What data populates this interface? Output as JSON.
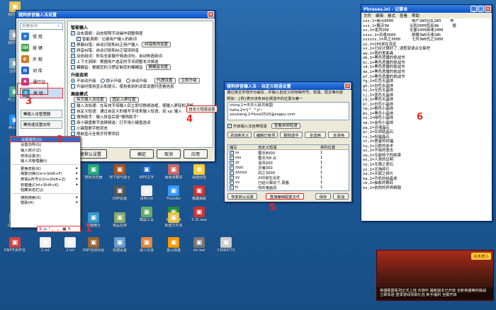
{
  "settings_window": {
    "title": "搜狗拼音输入法设置",
    "search_placeholder": "查看各项",
    "nav": [
      {
        "label": "常  用",
        "color": "#2e7ad1"
      },
      {
        "label": "按  键",
        "color": "#3d9a3d"
      },
      {
        "label": "外  观",
        "color": "#d07a20"
      },
      {
        "label": "词  库",
        "color": "#2a66c8"
      },
      {
        "label": "通行证",
        "color": "#c43c8a"
      },
      {
        "label": "高  级",
        "color": "#2e8fb0"
      }
    ],
    "nav_buttons": [
      "输入法管理器",
      "快速设置向导"
    ],
    "sections": {
      "smart": "智能输入",
      "upgrade": "升级选项",
      "advanced": "高级模式"
    },
    "smart_options": [
      "动态调频：动态按照手动操作调整频度",
      "智能调频：记录用户输入的新词",
      "屏蔽纠错：自动识别和纠正用户输入",
      "拼音纠错：自动识别和纠正错误拼音",
      "动态组词：所有全部展开候选词句，自动构造新词",
      "上下文调频：根据用户选定的字词调整本次候选",
      "模糊音：根据您的习惯定制您的模糊音"
    ],
    "smart_buttons": [
      "纠错规则设置",
      "模糊音设置"
    ],
    "upgrade_options": [
      "不自动升级",
      "提示升级",
      "自动升级"
    ],
    "upgrade_buttons": [
      "代理设置",
      "立即升级"
    ],
    "upgrade_note": "升级时使用显示和提示，使用收到的词库设置时查看信息",
    "advanced_buttons": [
      "英文输入法设置",
      "固定上屏位置"
    ],
    "advanced_options": [
      "输入法加速：在有效字母输入后立即切换候选框，使输入更轻松流畅",
      "自定义短语：通过自定义的缩写字母来输入短语，如 xjc 输入",
      "搜狗助手：输入拼音后按\"搜狗助手\"",
      "用小键盘数字选择候选：打开用小键盘选词",
      "小键盘数字框状态",
      "限制显示全角字符等项目"
    ],
    "custom_phrase_button": "自定义短语设置",
    "footer": [
      "恢复默认设置",
      "确定",
      "取消",
      "应用"
    ]
  },
  "context_menu": {
    "items": [
      {
        "label": "设置属性(O)",
        "sub": false,
        "selected": true
      },
      {
        "label": "设置向导(G)",
        "sub": false,
        "selected": false
      },
      {
        "label": "输入统计(Z)",
        "sub": false,
        "selected": false
      },
      {
        "label": "修改设置(E)",
        "sub": false,
        "selected": false
      },
      {
        "label": "输入法管理器(I)",
        "sub": false,
        "selected": false
      },
      {
        "label": "更换皮肤(K)",
        "sub": true,
        "selected": false
      },
      {
        "label": "简繁切换(Ctrl+Shift+F)",
        "sub": true,
        "selected": false
      },
      {
        "label": "表情&符号(Ctrl+Shift+Z)",
        "sub": true,
        "selected": false
      },
      {
        "label": "软键盘(Ctrl+Shift+K)",
        "sub": true,
        "selected": false
      },
      {
        "label": "隐藏状态栏(J)",
        "sub": false,
        "selected": false
      },
      {
        "label": "搜狗搜索(S)",
        "sub": true,
        "selected": false
      },
      {
        "label": "帮助(H)",
        "sub": true,
        "selected": false
      }
    ]
  },
  "ime_bar": {
    "logo": "S",
    "mode": "中",
    "items": [
      "°",
      "，",
      "。",
      "▦",
      "✎"
    ]
  },
  "phrase_dialog": {
    "title": "搜狗拼音输入法 - 自定义短语设置",
    "instructions": [
      "通过英文字母作为缩写，并输入自定义的特殊符号，短语，短文等内容",
      "例如：{例}表示该条目在候选中的位置为第一",
      "china,1=中华人民共和国",
      "haha,2=\\(^_^)/~"
    ],
    "textarea_lines": [
      "china,1=中华人民共和国",
      "haha,2=\\(^_^)/~",
      "youxiang,2=love2520@sogou.com"
    ],
    "link": "查看自带短语",
    "checkbox_label": "开启输入法自带短语",
    "buttons_row": [
      "添加新定义",
      "编辑已有项",
      "删除选中",
      "全选用",
      "全清用"
    ],
    "table_headers": [
      "缩写",
      "自定义短语",
      "排列位置"
    ],
    "table_rows": [
      {
        "abbr": "ss",
        "phrase": "蜀沃8000",
        "pos": "1"
      },
      {
        "abbr": "sss",
        "phrase": "蜀沃3W          尖",
        "pos": "1"
      },
      {
        "abbr": "zz",
        "phrase": "凛冽200         ",
        "pos": "1"
      },
      {
        "abbr": "zzzz",
        "phrase": "灵魂300",
        "pos": "1"
      },
      {
        "abbr": "zzzzzz",
        "phrase": "风之3000",
        "pos": "1"
      },
      {
        "abbr": "yy",
        "phrase": "200说在设定",
        "pos": "1"
      },
      {
        "abbr": "vv",
        "phrase": "已经计算好了,再看",
        "pos": "1"
      },
      {
        "abbr": "tt",
        "phrase": "你的鬼面具",
        "pos": "1"
      }
    ],
    "footer_buttons": [
      "恢复默认设置",
      "直接编辑配置文件",
      "保存",
      "取消"
    ]
  },
  "notepad": {
    "title": "Phrases.ini - 记事本",
    "menu": [
      "文件",
      "编辑",
      "格式",
      "查看",
      "帮助"
    ],
    "lines": [
      "zzz,1=蜀沃8000        嫉严2W3狂乱2W3    熊",
      "sss,1=蜀沃3W         尖刺2000死岳4W      擢",
      "zz,1=凛冽200         无量1000英魂1000",
      "zzzz,1=灵魂3600       剧属3W0天魂2W5",
      "zzzzzz,1=风之3000     七件3W0光之3000",
      "yy,1=200说在设定",
      "vv,1=已经计算好了,请惹就请点交易吧",
      "ww,1=我的鬼面具",
      "ab,1=黑色恶魔的挑战书",
      "bc,1=黑色恶魔的挑战书",
      "cd,1=黑色恶魔的挑战书",
      "de,1=黑色恶魔的挑战书",
      "ef,1=黑色恶魔的挑战书",
      "fg,1=红色天晶体",
      "gh,1=白色水晶体",
      "hi,1=无色天晶体",
      "ij,1=蓝色天晶体",
      "jk,1=黑色天晶体",
      "kl,1=白色小晶体",
      "lm,1=紫色小晶体",
      "mn,1=黑色小晶体",
      "no,1=绿色小晶体",
      "op,1=金色小晶体",
      "pq,1=灵魂晶石",
      "qr,1=灰烬结晶石",
      "rs,1=祝福晶石",
      "st,1=勇者的祝福",
      "tu,1=沉默的羔羊",
      "uv,1=不染的意志",
      "vw,1=无敌特子的勋章",
      "wx,1=人类的证明",
      "xy,1=无限之瓷石",
      "yz,1=天狗碎片",
      "za,1=天狐之碎片",
      "ba,1=开机的结晶体",
      "cb,1=抽象的数码",
      "bs,1=依附的异界精髓"
    ]
  },
  "desktop_icons": [
    {
      "label": "我的文档",
      "color": "#e8c24a"
    },
    {
      "label": "我的电脑",
      "color": "#9ab"
    },
    {
      "label": "回收站",
      "color": "#7ab"
    },
    {
      "label": "网上邻居",
      "color": "#4a8"
    },
    {
      "label": "腾讯QQ",
      "color": "#1e90ff"
    },
    {
      "label": "天龙八部",
      "color": "#b33"
    },
    {
      "label": "搜狗浏览器",
      "color": "#2a7"
    },
    {
      "label": "地下城与勇士",
      "color": "#a52"
    },
    {
      "label": "WPS文字",
      "color": "#1c5cb8"
    },
    {
      "label": "兔兔收藏夹",
      "color": "#c66"
    },
    {
      "label": "桌面便签",
      "color": "#fc3"
    },
    {
      "label": "DNF配置",
      "color": "#555"
    },
    {
      "label": "说明.txt",
      "color": "#eee"
    },
    {
      "label": "Thunder",
      "color": "#39f"
    },
    {
      "label": "快捷方式",
      "color": "#888"
    },
    {
      "label": "百度网盘",
      "color": "#3af"
    },
    {
      "label": "截图工具",
      "color": "#6a6"
    },
    {
      "label": "WPS表格",
      "color": "#2a8a3a"
    },
    {
      "label": "5.31.exe",
      "color": "#c33"
    },
    {
      "label": "6.2.exe",
      "color": "#c33"
    },
    {
      "label": "DNF助手",
      "color": "#aa3"
    },
    {
      "label": "1.txt",
      "color": "#eee"
    },
    {
      "label": "2.txt",
      "color": "#eee"
    },
    {
      "label": "DNF自动补给",
      "color": "#963"
    },
    {
      "label": "快捷设置",
      "color": "#69c"
    },
    {
      "label": "战斗记录",
      "color": "#d84"
    },
    {
      "label": "金山快盘",
      "color": "#f90"
    },
    {
      "label": "sfz.bat",
      "color": "#777"
    },
    {
      "label": "DNF开启开关",
      "color": "#c44"
    },
    {
      "label": "按键精灵",
      "color": "#39c"
    },
    {
      "label": "物品名称",
      "color": "#8a6"
    },
    {
      "label": "新建文件夹",
      "color": "#e8c24a"
    },
    {
      "label": "13069772",
      "color": "#ccc"
    }
  ],
  "game_ad": {
    "caption": "英雄联盟系列正式上线 内测中 最新版本已开放 全新英雄等你挑战 立即体验 登录游戏领取礼包 新手福利 全服开启",
    "badge": "点击进入"
  },
  "annotations": [
    "1",
    "2",
    "3",
    "4",
    "5",
    "6"
  ],
  "colors": {
    "accent_red": "#e22",
    "titlebar": "#0a52c8",
    "highlight": "#316ac5"
  }
}
